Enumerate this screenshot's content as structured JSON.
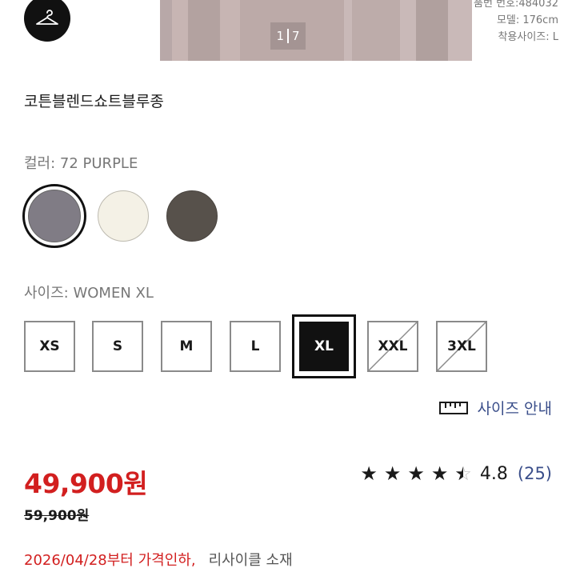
{
  "hero": {
    "page_indicator": {
      "current": "1",
      "total": "7"
    },
    "model_info": {
      "product_no": "품번 번호:484032",
      "model": "모델: 176cm",
      "wear_size": "착용사이즈: L"
    }
  },
  "product": {
    "title": "코튼블렌드쇼트블루종"
  },
  "color": {
    "label": "컬러: 72 PURPLE",
    "swatches": [
      {
        "name": "purple",
        "hex": "#807c85",
        "selected": true
      },
      {
        "name": "cream",
        "hex": "#f4f1e6",
        "selected": false
      },
      {
        "name": "olive",
        "hex": "#57514b",
        "selected": false
      }
    ]
  },
  "size": {
    "label": "사이즈: WOMEN XL",
    "options": [
      {
        "label": "XS",
        "state": "available"
      },
      {
        "label": "S",
        "state": "available"
      },
      {
        "label": "M",
        "state": "available"
      },
      {
        "label": "L",
        "state": "available"
      },
      {
        "label": "XL",
        "state": "selected"
      },
      {
        "label": "XXL",
        "state": "soldout"
      },
      {
        "label": "3XL",
        "state": "soldout"
      }
    ],
    "guide_label": "사이즈 안내"
  },
  "pricing": {
    "price": "49,900원",
    "original_price": "59,900원",
    "price_color": "#d21f1f"
  },
  "rating": {
    "value": "4.8",
    "count": "(25)",
    "stars": 4.5
  },
  "notice": {
    "price_drop": "2026/04/28부터 가격인하,",
    "material": "리사이클 소재"
  }
}
